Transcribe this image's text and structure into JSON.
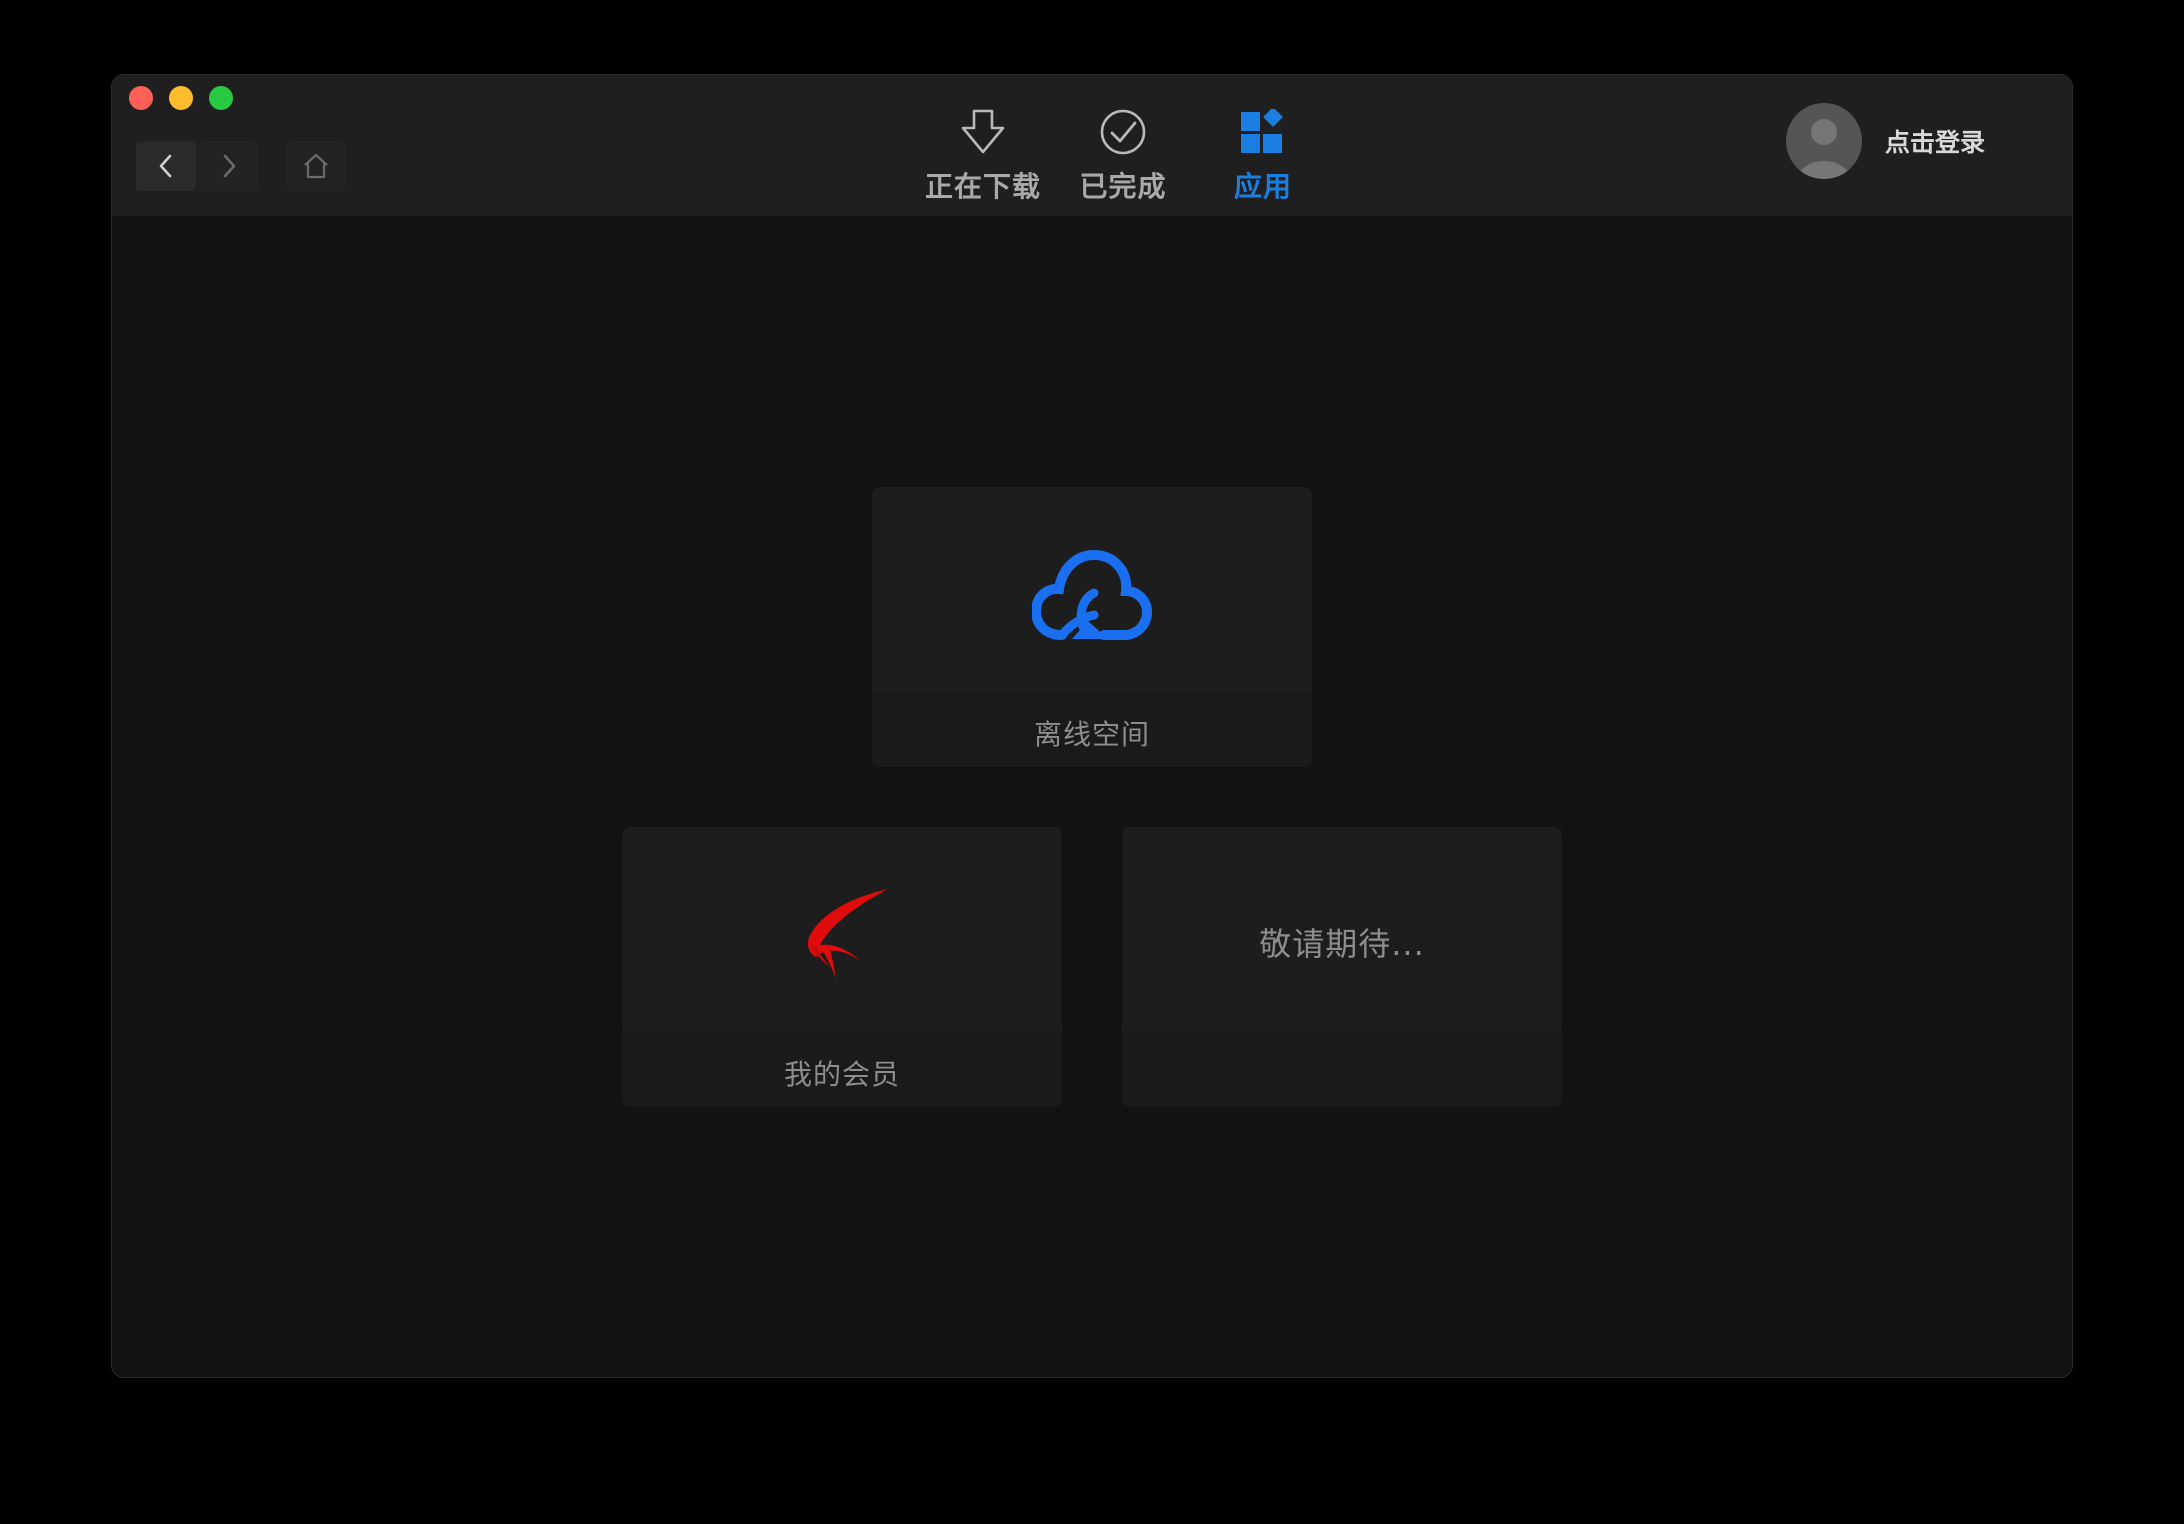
{
  "window": {
    "traffic_lights": {
      "close": "#fe5f57",
      "minimize": "#febc2e",
      "maximize": "#28c840"
    }
  },
  "nav": {
    "back_icon": "chevron-left-icon",
    "forward_icon": "chevron-right-icon",
    "home_icon": "home-icon"
  },
  "tabs": [
    {
      "label": "正在下载",
      "icon": "download-arrow-icon",
      "active": false
    },
    {
      "label": "已完成",
      "icon": "check-circle-icon",
      "active": false
    },
    {
      "label": "应用",
      "icon": "apps-grid-icon",
      "active": true
    }
  ],
  "user": {
    "login_label": "点击登录",
    "avatar_icon": "user-avatar-icon"
  },
  "apps": [
    {
      "label": "离线空间",
      "icon": "cloud-icon",
      "icon_color": "#1a6ff0"
    },
    {
      "label": "我的会员",
      "icon": "bird-logo-icon",
      "icon_color": "#e00b0b"
    },
    {
      "label": "敬请期待..."
    }
  ],
  "colors": {
    "accent": "#1a7fe0",
    "tab_text": "#a9a9a9",
    "card_bg": "#1d1d1d",
    "window_bg": "#121212"
  }
}
